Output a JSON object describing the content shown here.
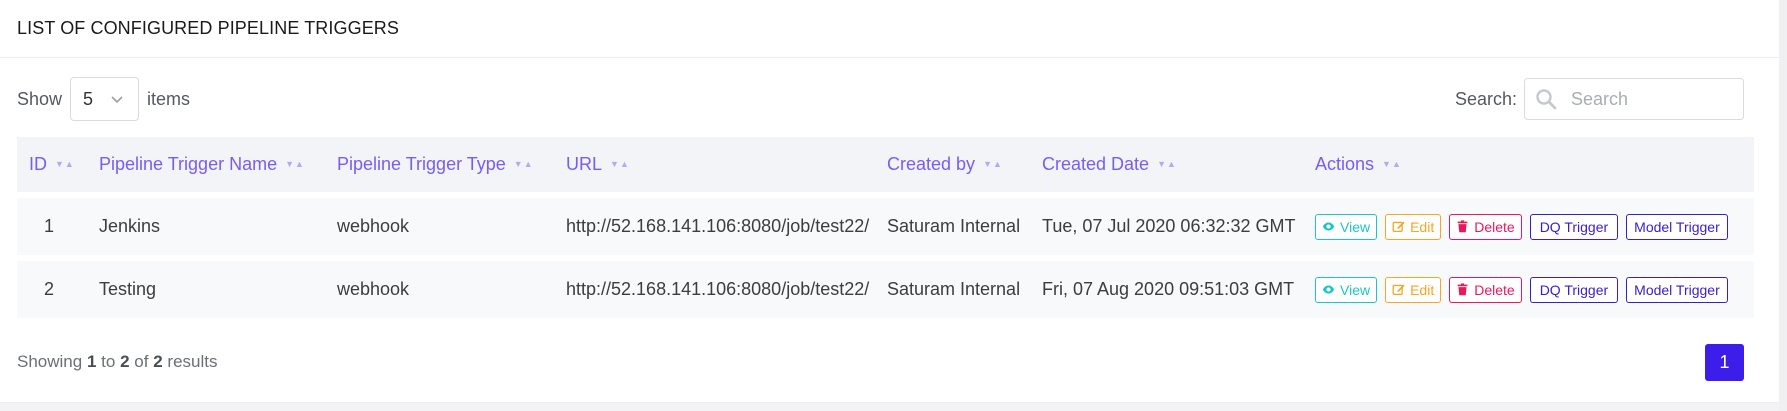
{
  "header": {
    "title": "LIST OF CONFIGURED PIPELINE TRIGGERS"
  },
  "controls": {
    "show_label": "Show",
    "page_size": "5",
    "items_label": "items",
    "search_label": "Search:",
    "search_placeholder": "Search",
    "search_value": ""
  },
  "table": {
    "columns": [
      "ID",
      "Pipeline Trigger Name",
      "Pipeline Trigger Type",
      "URL",
      "Created by",
      "Created Date",
      "Actions"
    ],
    "rows": [
      {
        "id": "1",
        "name": "Jenkins",
        "type": "webhook",
        "url": "http://52.168.141.106:8080/job/test22/",
        "created_by": "Saturam Internal",
        "created_date": "Tue, 07 Jul 2020 06:32:32 GMT"
      },
      {
        "id": "2",
        "name": "Testing",
        "type": "webhook",
        "url": "http://52.168.141.106:8080/job/test22/",
        "created_by": "Saturam Internal",
        "created_date": "Fri, 07 Aug 2020 09:51:03 GMT"
      }
    ],
    "actions": {
      "view": "View",
      "edit": "Edit",
      "delete": "Delete",
      "dq_trigger": "DQ Trigger",
      "model_trigger": "Model Trigger"
    }
  },
  "footer": {
    "showing_prefix": "Showing",
    "from": "1",
    "to_word": "to",
    "to": "2",
    "of_word": "of",
    "total": "2",
    "results_word": "results",
    "current_page": "1"
  },
  "colors": {
    "header_text": "#7b5cf0",
    "view": "#1ec5c5",
    "edit": "#f5a623",
    "delete": "#e8185c",
    "trigger": "#3a1ec8",
    "pagination_active": "#3d1de9"
  },
  "icons": {
    "search": "search-icon",
    "view": "eye-icon",
    "edit": "edit-icon",
    "delete": "trash-icon",
    "sort": "sort-icon",
    "select": "chevron-down-icon"
  }
}
